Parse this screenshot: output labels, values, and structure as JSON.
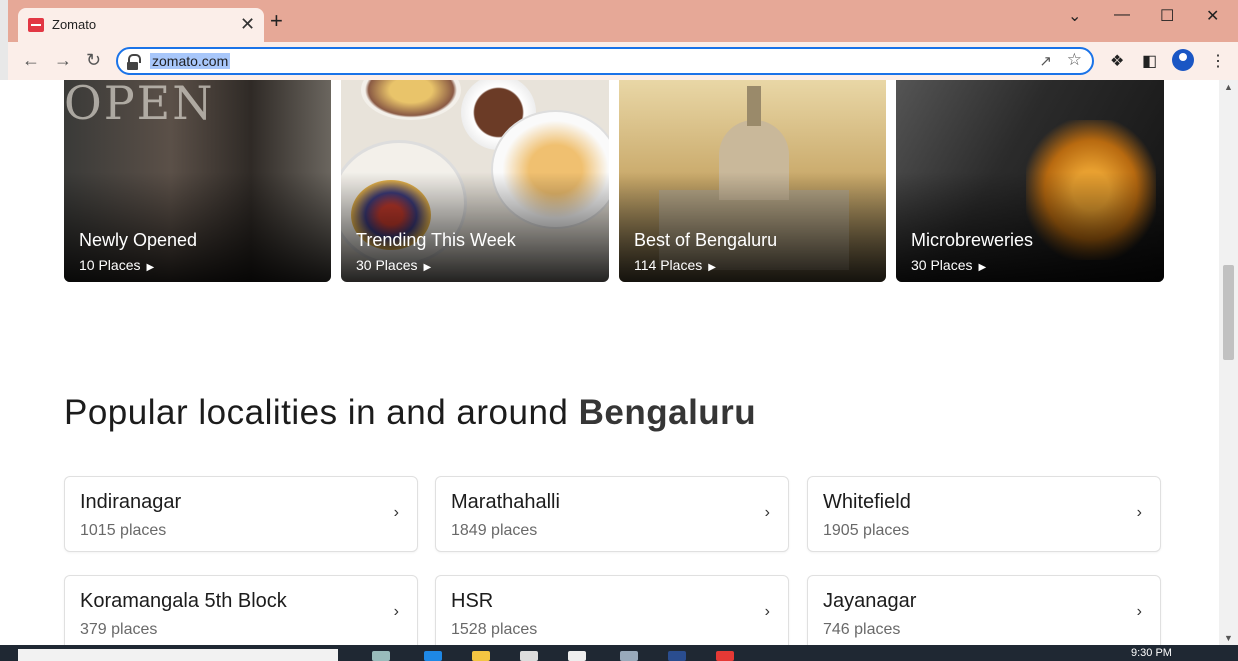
{
  "browser": {
    "tab_title": "Zomato",
    "tab_close": "✕",
    "new_tab": "+",
    "url": "zomato.com",
    "window_controls": [
      "⌄",
      "—",
      "☐",
      "✕"
    ]
  },
  "collections": [
    {
      "title": "Newly Opened",
      "places": "10 Places",
      "overlay_text": "OPEN"
    },
    {
      "title": "Trending This Week",
      "places": "30 Places"
    },
    {
      "title": "Best of Bengaluru",
      "places": "114 Places"
    },
    {
      "title": "Microbreweries",
      "places": "30 Places"
    }
  ],
  "section": {
    "heading_prefix": "Popular localities in and around ",
    "heading_city": "Bengaluru"
  },
  "localities": [
    {
      "name": "Indiranagar",
      "count": "1015 places"
    },
    {
      "name": "Marathahalli",
      "count": "1849 places"
    },
    {
      "name": "Whitefield",
      "count": "1905 places"
    },
    {
      "name": "Koramangala 5th Block",
      "count": "379 places"
    },
    {
      "name": "HSR",
      "count": "1528 places"
    },
    {
      "name": "Jayanagar",
      "count": "746 places"
    }
  ],
  "taskbar": {
    "clock": "9:30 PM"
  },
  "colors": {
    "tabbar": "#e6a897",
    "brand_red": "#e23744",
    "focus_blue": "#1a73e8"
  }
}
